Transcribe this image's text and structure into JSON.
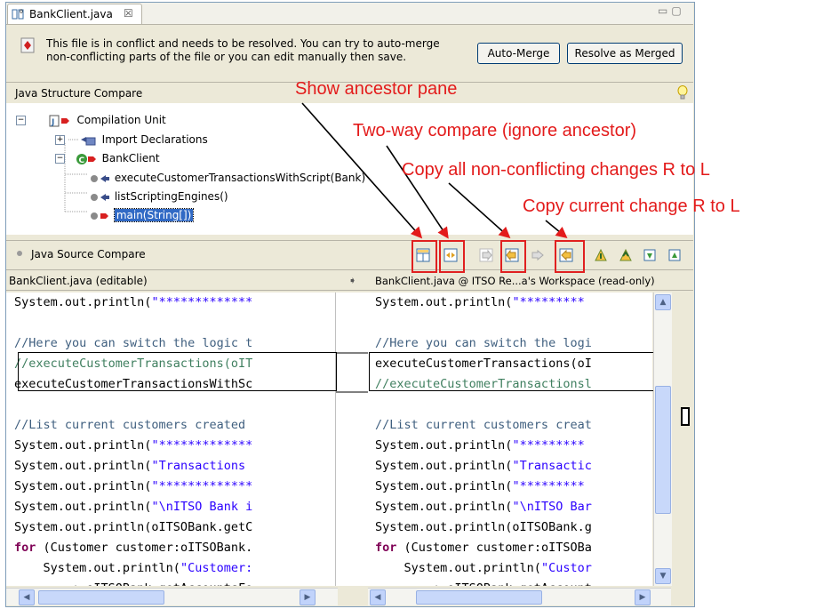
{
  "tab": {
    "title": "BankClient.java",
    "close": "☒"
  },
  "banner": {
    "line1": "This file is in conflict and needs to be resolved. You can try to auto-merge",
    "line2": "non-conflicting parts of the file or you can edit manually then save.",
    "auto_merge": "Auto-Merge",
    "resolve": "Resolve as Merged"
  },
  "structure": {
    "title": "Java Structure Compare",
    "items": [
      {
        "label": "Compilation Unit"
      },
      {
        "label": "Import Declarations"
      },
      {
        "label": "BankClient"
      },
      {
        "label": "executeCustomerTransactionsWithScript(Bank)"
      },
      {
        "label": "listScriptingEngines()"
      },
      {
        "label": "main(String[])"
      }
    ]
  },
  "source": {
    "title": "Java Source Compare",
    "left_title": "BankClient.java  (editable)",
    "right_title": "BankClient.java @ ITSO Re...a's Workspace (read-only)"
  },
  "left_lines": [
    [
      "System.out.println(",
      "\"*************"
    ],
    [
      "",
      ""
    ],
    [
      "//Here you can switch the logic t",
      ""
    ],
    [
      "//executeCustomerTransactions(oIT",
      ""
    ],
    [
      "executeCustomerTransactionsWithSc",
      ""
    ],
    [
      "",
      ""
    ],
    [
      "//List current customers created ",
      ""
    ],
    [
      "System.out.println(",
      "\"*************"
    ],
    [
      "System.out.println(",
      "\"Transactions "
    ],
    [
      "System.out.println(",
      "\"*************"
    ],
    [
      "System.out.println(",
      "\"\\nITSO Bank i"
    ],
    [
      "System.out.println(oITSOBank.getC",
      ""
    ],
    [
      "for",
      " (Customer customer:oITSOBank."
    ],
    [
      "    System.out.println(",
      "\"Customer:"
    ],
    [
      "        + oITSOBank.getAccountsFo",
      ""
    ]
  ],
  "right_lines": [
    [
      "System.out.println(",
      "\"*********"
    ],
    [
      "",
      ""
    ],
    [
      "//Here you can switch the logi",
      ""
    ],
    [
      "executeCustomerTransactions(oI",
      ""
    ],
    [
      "//executeCustomerTransactionsl",
      ""
    ],
    [
      "",
      ""
    ],
    [
      "//List current customers creat",
      ""
    ],
    [
      "System.out.println(",
      "\"*********"
    ],
    [
      "System.out.println(",
      "\"Transactic"
    ],
    [
      "System.out.println(",
      "\"*********"
    ],
    [
      "System.out.println(",
      "\"\\nITSO Bar"
    ],
    [
      "System.out.println(oITSOBank.g",
      ""
    ],
    [
      "for",
      " (Customer customer:oITSOBa"
    ],
    [
      "    System.out.println(",
      "\"Custor"
    ],
    [
      "        + oITSOBank.getAccount",
      ""
    ]
  ],
  "annotations": {
    "a1": "Show ancestor pane",
    "a2": "Two-way compare (ignore ancestor)",
    "a3": "Copy all non-conflicting changes R to L",
    "a4": "Copy current change R to L"
  },
  "colors": {
    "accent": "#e31b1b",
    "selection": "#316ac5"
  }
}
